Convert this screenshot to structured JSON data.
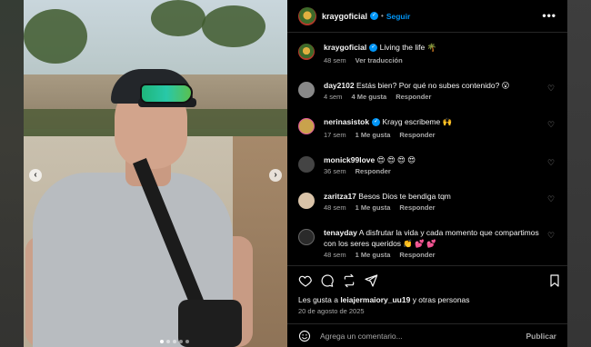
{
  "post": {
    "username": "kraygoficial",
    "follow_label": "Seguir",
    "separator": "•",
    "more_label": "•••"
  },
  "caption": {
    "username": "kraygoficial",
    "text": "Living the life 🌴",
    "time": "48 sem",
    "translate_label": "Ver traducción"
  },
  "comments": [
    {
      "username": "day2102",
      "text": "Estás bien? Por qué no subes contenido? 😮",
      "time": "4 sem",
      "likes": "4 Me gusta",
      "reply": "Responder",
      "verified": false
    },
    {
      "username": "nerinasistok",
      "text": "Krayg escribeme 🙌",
      "time": "17 sem",
      "likes": "1 Me gusta",
      "reply": "Responder",
      "verified": true
    },
    {
      "username": "monick99love",
      "text": "😍 😍 😍 😍",
      "time": "36 sem",
      "likes": "",
      "reply": "Responder",
      "verified": false
    },
    {
      "username": "zaritza17",
      "text": "Besos Dios te bendiga tqm",
      "time": "48 sem",
      "likes": "1 Me gusta",
      "reply": "Responder",
      "verified": false
    },
    {
      "username": "tenayday",
      "text": "A disfrutar la vida y cada momento que compartimos con los seres queridos 👏 💕 💕",
      "time": "48 sem",
      "likes": "1 Me gusta",
      "reply": "Responder",
      "verified": false
    }
  ],
  "likes_line": {
    "prefix": "Les gusta a ",
    "user": "leiajermaiory_uu19",
    "suffix": " y otras personas"
  },
  "date": "20 de agosto de 2025",
  "comment_box": {
    "placeholder": "Agrega un comentario...",
    "publish_label": "Publicar"
  },
  "colors": {
    "accent": "#0095f6",
    "panel_bg": "#000000",
    "muted_text": "#a8a8a8"
  }
}
